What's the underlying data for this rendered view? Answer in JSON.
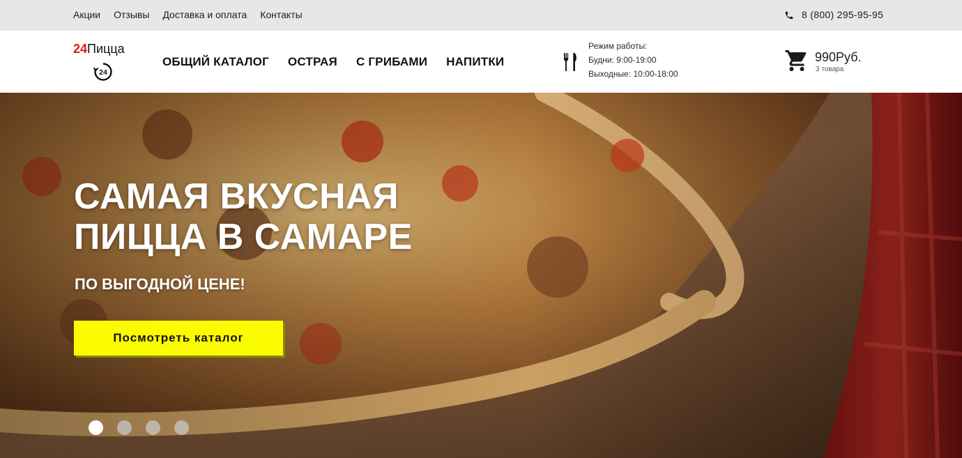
{
  "topbar": {
    "links": [
      "Акции",
      "Отзывы",
      "Доставка и оплата",
      "Контакты"
    ],
    "phone": "8 (800) 295-95-95"
  },
  "header": {
    "logo": {
      "number": "24",
      "name": "Пицца",
      "badge": "24"
    },
    "nav": [
      "ОБЩИЙ КАТАЛОГ",
      "ОСТРАЯ",
      "С ГРИБАМИ",
      "НАПИТКИ"
    ],
    "hours": {
      "title": "Режим работы:",
      "weekdays": "Будни: 9:00-19:00",
      "weekend": "Выходные: 10:00-18:00"
    },
    "cart": {
      "total": "990Руб.",
      "count": "3 товара"
    }
  },
  "hero": {
    "title_line1": "САМАЯ ВКУСНАЯ",
    "title_line2": "ПИЦЦА В САМАРЕ",
    "subtitle": "ПО ВЫГОДНОЙ ЦЕНЕ!",
    "cta": "Посмотреть каталог",
    "slides": 4,
    "active_slide": 1
  },
  "colors": {
    "accent_yellow": "#fbfc02",
    "logo_red": "#e11a1a",
    "topbar_bg": "#e8e6e6"
  },
  "icons": [
    "phone-icon",
    "clock-24-icon",
    "cutlery-icon",
    "cart-icon"
  ]
}
